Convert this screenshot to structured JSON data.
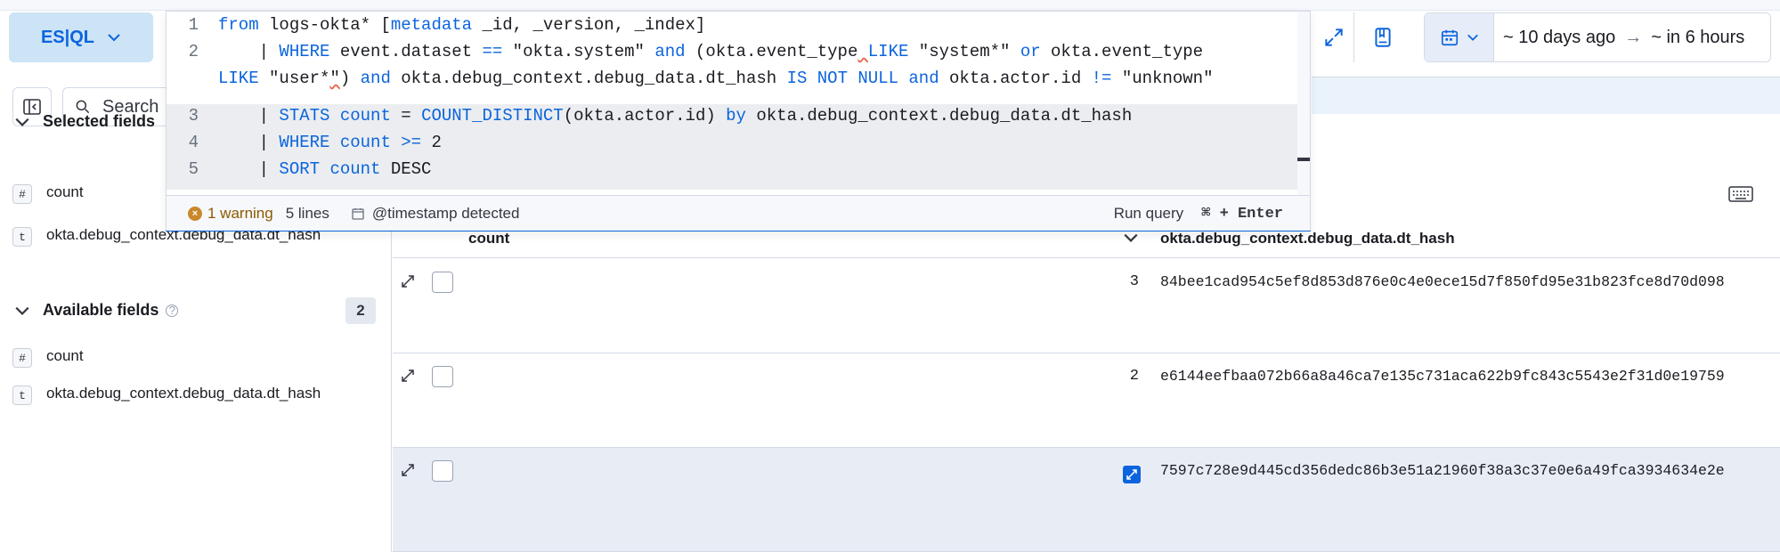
{
  "toolbar": {
    "language_button": "ES|QL",
    "time_range": {
      "start": "~ 10 days ago",
      "arrow": "→",
      "end": "~ in 6 hours"
    }
  },
  "editor": {
    "lines": [
      {
        "n": "1",
        "segments": [
          {
            "t": "from",
            "c": "kw"
          },
          {
            "t": " logs-okta* [",
            "c": ""
          },
          {
            "t": "metadata",
            "c": "kw"
          },
          {
            "t": " _id, _version, _index]",
            "c": ""
          }
        ]
      },
      {
        "n": "2",
        "segments": [
          {
            "t": "    | ",
            "c": ""
          },
          {
            "t": "WHERE",
            "c": "kw"
          },
          {
            "t": " event.dataset ",
            "c": ""
          },
          {
            "t": "==",
            "c": "op"
          },
          {
            "t": " \"okta.system\" ",
            "c": ""
          },
          {
            "t": "and",
            "c": "kw"
          },
          {
            "t": " (okta.event_type",
            "c": ""
          },
          {
            "t": " ",
            "c": "warn"
          },
          {
            "t": "LIKE",
            "c": "kw"
          },
          {
            "t": " \"system*\" ",
            "c": ""
          },
          {
            "t": "or",
            "c": "kw"
          },
          {
            "t": " okta.event_type",
            "c": ""
          }
        ]
      },
      {
        "n": "",
        "segments": [
          {
            "t": "LIKE",
            "c": "kw"
          },
          {
            "t": " \"user*",
            "c": ""
          },
          {
            "t": "\"",
            "c": "warn"
          },
          {
            "t": ") ",
            "c": ""
          },
          {
            "t": "and",
            "c": "kw"
          },
          {
            "t": " okta.debug_context.debug_data.dt_hash ",
            "c": ""
          },
          {
            "t": "IS NOT NULL",
            "c": "kw"
          },
          {
            "t": " ",
            "c": ""
          },
          {
            "t": "and",
            "c": "kw"
          },
          {
            "t": " okta.actor.id ",
            "c": ""
          },
          {
            "t": "!=",
            "c": "op"
          },
          {
            "t": " \"unknown\"",
            "c": ""
          }
        ]
      },
      {
        "n": "3",
        "segments": [
          {
            "t": "    | ",
            "c": ""
          },
          {
            "t": "STATS",
            "c": "kw"
          },
          {
            "t": " ",
            "c": ""
          },
          {
            "t": "count",
            "c": "kw"
          },
          {
            "t": " = ",
            "c": ""
          },
          {
            "t": "COUNT_DISTINCT",
            "c": "kw"
          },
          {
            "t": "(okta.actor.id) ",
            "c": ""
          },
          {
            "t": "by",
            "c": "kw"
          },
          {
            "t": " okta.debug_context.debug_data.dt_hash",
            "c": ""
          }
        ]
      },
      {
        "n": "4",
        "segments": [
          {
            "t": "    | ",
            "c": ""
          },
          {
            "t": "WHERE",
            "c": "kw"
          },
          {
            "t": " ",
            "c": ""
          },
          {
            "t": "count",
            "c": "kw"
          },
          {
            "t": " ",
            "c": ""
          },
          {
            "t": ">=",
            "c": "op"
          },
          {
            "t": " 2",
            "c": ""
          }
        ]
      },
      {
        "n": "5",
        "segments": [
          {
            "t": "    | ",
            "c": ""
          },
          {
            "t": "SORT",
            "c": "kw"
          },
          {
            "t": " ",
            "c": ""
          },
          {
            "t": "count",
            "c": "kw"
          },
          {
            "t": " DESC",
            "c": ""
          }
        ]
      }
    ],
    "footer": {
      "warning": "1 warning",
      "lines": "5 lines",
      "timestamp": "@timestamp detected",
      "run_label": "Run query",
      "shortcut": "⌘ + Enter"
    }
  },
  "sidebar": {
    "search_placeholder": "Search",
    "selected_title": "Selected fields",
    "available_title": "Available fields",
    "available_count": "2",
    "selected_fields": [
      {
        "type": "#",
        "name": "count"
      },
      {
        "type": "t",
        "name": "okta.debug_context.debug_data.dt_hash"
      }
    ],
    "available_fields": [
      {
        "type": "#",
        "name": "count"
      },
      {
        "type": "t",
        "name": "okta.debug_context.debug_data.dt_hash"
      }
    ]
  },
  "table": {
    "columns": {
      "count": "count",
      "hash": "okta.debug_context.debug_data.dt_hash"
    },
    "rows": [
      {
        "count": "3",
        "hash": "84bee1cad954c5ef8d853d876e0c4e0ece15d7f850fd95e31b823fce8d70d098",
        "selected": false
      },
      {
        "count": "2",
        "hash": "e6144eefbaa072b66a8a46ca7e135c731aca622b9fc843c5543e2f31d0e19759",
        "selected": false
      },
      {
        "count": "",
        "hash": "7597c728e9d445cd356dedc86b3e51a21960f38a3c37e0e6a49fca3934634e2e",
        "selected": true
      }
    ]
  }
}
